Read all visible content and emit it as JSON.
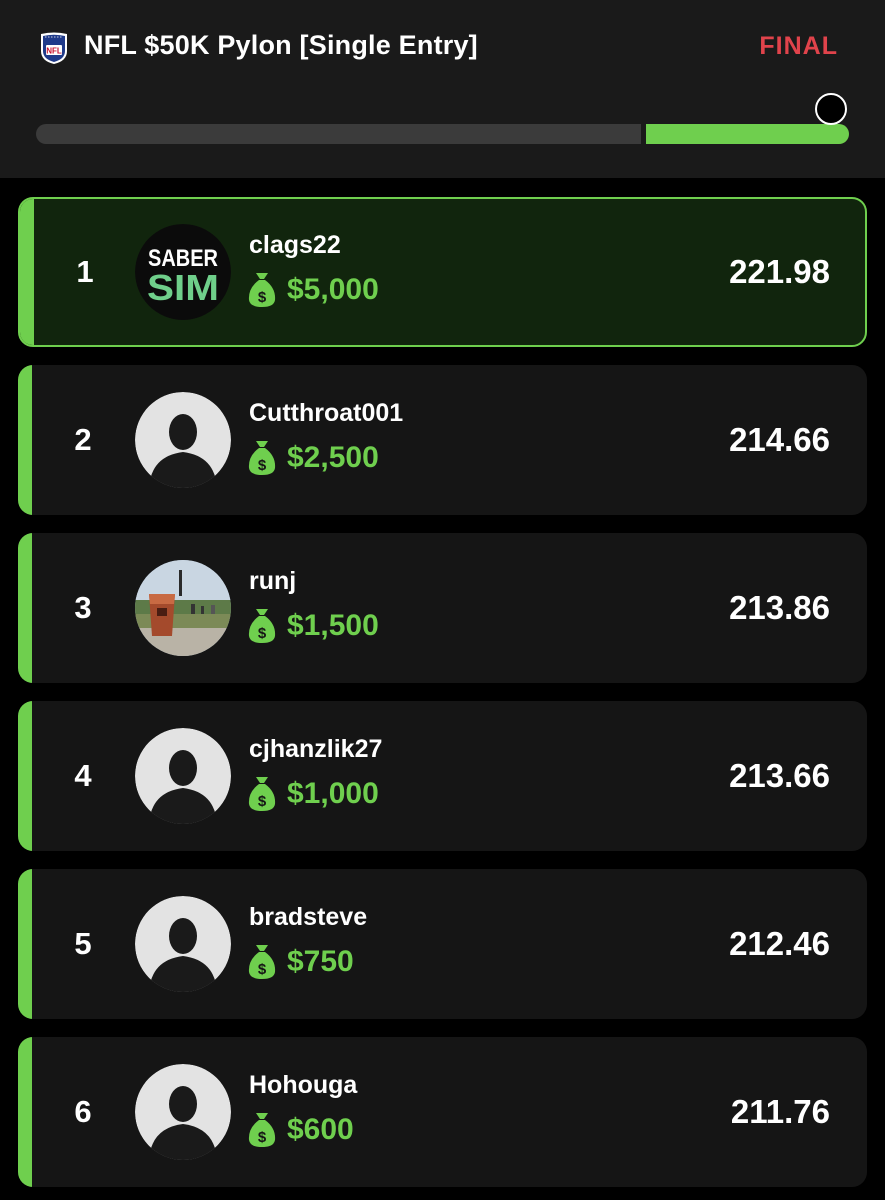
{
  "header": {
    "contest_title": "NFL $50K Pylon [Single Entry]",
    "status": "FINAL",
    "logo_icon": "nfl-shield-icon",
    "logo_text": "NFL",
    "progress_fraction": 0.25
  },
  "colors": {
    "accent_green": "#6fcf4e",
    "status_red": "#e0434b",
    "track_gray": "#3b3b3b"
  },
  "leaderboard": [
    {
      "rank": "1",
      "username": "clags22",
      "prize": "$5,000",
      "score": "221.98",
      "avatar": "sabersim-logo",
      "avatar_text": [
        "SABER",
        "SIM"
      ]
    },
    {
      "rank": "2",
      "username": "Cutthroat001",
      "prize": "$2,500",
      "score": "214.66",
      "avatar": "default-user-icon"
    },
    {
      "rank": "3",
      "username": "runj",
      "prize": "$1,500",
      "score": "213.86",
      "avatar": "drink-photo"
    },
    {
      "rank": "4",
      "username": "cjhanzlik27",
      "prize": "$1,000",
      "score": "213.66",
      "avatar": "default-user-icon"
    },
    {
      "rank": "5",
      "username": "bradsteve",
      "prize": "$750",
      "score": "212.46",
      "avatar": "default-user-icon"
    },
    {
      "rank": "6",
      "username": "Hohouga",
      "prize": "$600",
      "score": "211.76",
      "avatar": "default-user-icon"
    }
  ]
}
